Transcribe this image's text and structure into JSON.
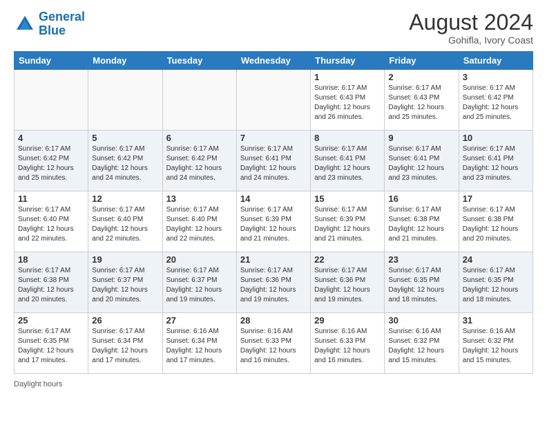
{
  "header": {
    "logo_line1": "General",
    "logo_line2": "Blue",
    "month_year": "August 2024",
    "location": "Gohifla, Ivory Coast"
  },
  "weekdays": [
    "Sunday",
    "Monday",
    "Tuesday",
    "Wednesday",
    "Thursday",
    "Friday",
    "Saturday"
  ],
  "footer": {
    "daylight_label": "Daylight hours"
  },
  "weeks": [
    [
      {
        "day": "",
        "info": ""
      },
      {
        "day": "",
        "info": ""
      },
      {
        "day": "",
        "info": ""
      },
      {
        "day": "",
        "info": ""
      },
      {
        "day": "1",
        "info": "Sunrise: 6:17 AM\nSunset: 6:43 PM\nDaylight: 12 hours\nand 26 minutes."
      },
      {
        "day": "2",
        "info": "Sunrise: 6:17 AM\nSunset: 6:43 PM\nDaylight: 12 hours\nand 25 minutes."
      },
      {
        "day": "3",
        "info": "Sunrise: 6:17 AM\nSunset: 6:42 PM\nDaylight: 12 hours\nand 25 minutes."
      }
    ],
    [
      {
        "day": "4",
        "info": "Sunrise: 6:17 AM\nSunset: 6:42 PM\nDaylight: 12 hours\nand 25 minutes."
      },
      {
        "day": "5",
        "info": "Sunrise: 6:17 AM\nSunset: 6:42 PM\nDaylight: 12 hours\nand 24 minutes."
      },
      {
        "day": "6",
        "info": "Sunrise: 6:17 AM\nSunset: 6:42 PM\nDaylight: 12 hours\nand 24 minutes."
      },
      {
        "day": "7",
        "info": "Sunrise: 6:17 AM\nSunset: 6:41 PM\nDaylight: 12 hours\nand 24 minutes."
      },
      {
        "day": "8",
        "info": "Sunrise: 6:17 AM\nSunset: 6:41 PM\nDaylight: 12 hours\nand 23 minutes."
      },
      {
        "day": "9",
        "info": "Sunrise: 6:17 AM\nSunset: 6:41 PM\nDaylight: 12 hours\nand 23 minutes."
      },
      {
        "day": "10",
        "info": "Sunrise: 6:17 AM\nSunset: 6:41 PM\nDaylight: 12 hours\nand 23 minutes."
      }
    ],
    [
      {
        "day": "11",
        "info": "Sunrise: 6:17 AM\nSunset: 6:40 PM\nDaylight: 12 hours\nand 22 minutes."
      },
      {
        "day": "12",
        "info": "Sunrise: 6:17 AM\nSunset: 6:40 PM\nDaylight: 12 hours\nand 22 minutes."
      },
      {
        "day": "13",
        "info": "Sunrise: 6:17 AM\nSunset: 6:40 PM\nDaylight: 12 hours\nand 22 minutes."
      },
      {
        "day": "14",
        "info": "Sunrise: 6:17 AM\nSunset: 6:39 PM\nDaylight: 12 hours\nand 21 minutes."
      },
      {
        "day": "15",
        "info": "Sunrise: 6:17 AM\nSunset: 6:39 PM\nDaylight: 12 hours\nand 21 minutes."
      },
      {
        "day": "16",
        "info": "Sunrise: 6:17 AM\nSunset: 6:38 PM\nDaylight: 12 hours\nand 21 minutes."
      },
      {
        "day": "17",
        "info": "Sunrise: 6:17 AM\nSunset: 6:38 PM\nDaylight: 12 hours\nand 20 minutes."
      }
    ],
    [
      {
        "day": "18",
        "info": "Sunrise: 6:17 AM\nSunset: 6:38 PM\nDaylight: 12 hours\nand 20 minutes."
      },
      {
        "day": "19",
        "info": "Sunrise: 6:17 AM\nSunset: 6:37 PM\nDaylight: 12 hours\nand 20 minutes."
      },
      {
        "day": "20",
        "info": "Sunrise: 6:17 AM\nSunset: 6:37 PM\nDaylight: 12 hours\nand 19 minutes."
      },
      {
        "day": "21",
        "info": "Sunrise: 6:17 AM\nSunset: 6:36 PM\nDaylight: 12 hours\nand 19 minutes."
      },
      {
        "day": "22",
        "info": "Sunrise: 6:17 AM\nSunset: 6:36 PM\nDaylight: 12 hours\nand 19 minutes."
      },
      {
        "day": "23",
        "info": "Sunrise: 6:17 AM\nSunset: 6:35 PM\nDaylight: 12 hours\nand 18 minutes."
      },
      {
        "day": "24",
        "info": "Sunrise: 6:17 AM\nSunset: 6:35 PM\nDaylight: 12 hours\nand 18 minutes."
      }
    ],
    [
      {
        "day": "25",
        "info": "Sunrise: 6:17 AM\nSunset: 6:35 PM\nDaylight: 12 hours\nand 17 minutes."
      },
      {
        "day": "26",
        "info": "Sunrise: 6:17 AM\nSunset: 6:34 PM\nDaylight: 12 hours\nand 17 minutes."
      },
      {
        "day": "27",
        "info": "Sunrise: 6:16 AM\nSunset: 6:34 PM\nDaylight: 12 hours\nand 17 minutes."
      },
      {
        "day": "28",
        "info": "Sunrise: 6:16 AM\nSunset: 6:33 PM\nDaylight: 12 hours\nand 16 minutes."
      },
      {
        "day": "29",
        "info": "Sunrise: 6:16 AM\nSunset: 6:33 PM\nDaylight: 12 hours\nand 16 minutes."
      },
      {
        "day": "30",
        "info": "Sunrise: 6:16 AM\nSunset: 6:32 PM\nDaylight: 12 hours\nand 15 minutes."
      },
      {
        "day": "31",
        "info": "Sunrise: 6:16 AM\nSunset: 6:32 PM\nDaylight: 12 hours\nand 15 minutes."
      }
    ]
  ]
}
